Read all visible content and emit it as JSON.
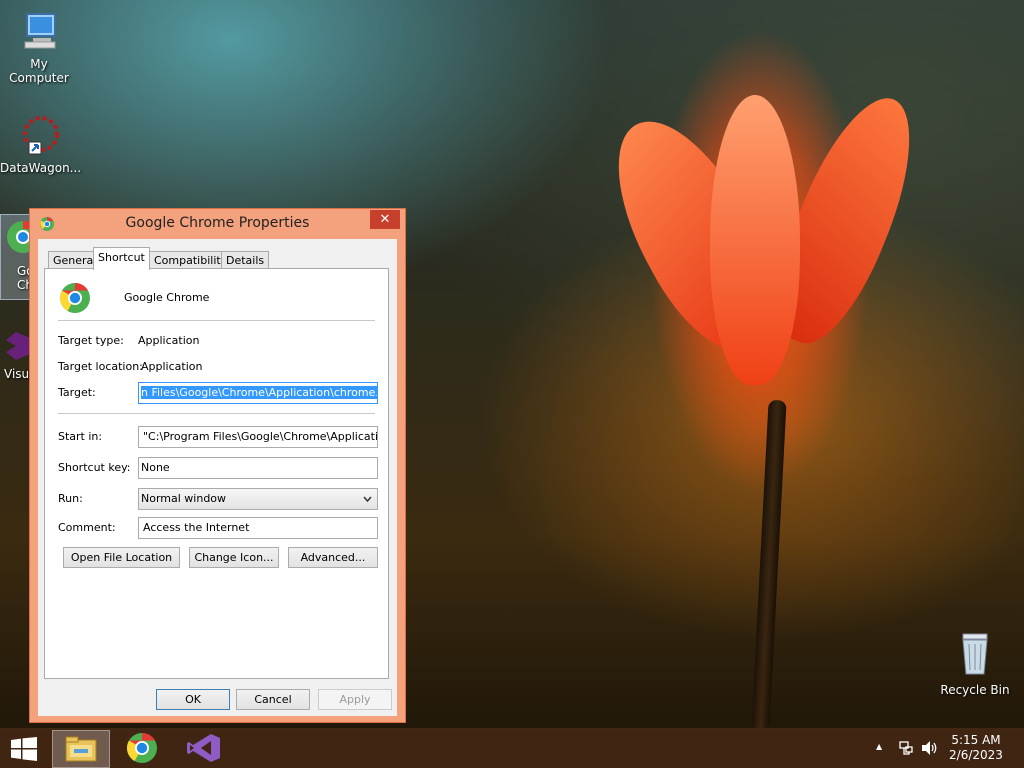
{
  "desktop": {
    "icons": [
      {
        "label": "My Computer"
      },
      {
        "label": "DataWagon..."
      },
      {
        "label": "Go Chr"
      },
      {
        "label": "Visua"
      },
      {
        "label": "Recycle Bin"
      }
    ]
  },
  "dialog": {
    "title": "Google Chrome Properties",
    "close_glyph": "✕",
    "tabs": [
      {
        "label": "General"
      },
      {
        "label": "Shortcut"
      },
      {
        "label": "Compatibility"
      },
      {
        "label": "Details"
      }
    ],
    "active_tab": "Shortcut",
    "app_name": "Google Chrome",
    "target_type_label": "Target type:",
    "target_type_value": "Application",
    "target_location_label": "Target location:",
    "target_location_value": "Application",
    "target_label": "Target:",
    "target_value": "n Files\\Google\\Chrome\\Application\\chrome.exe\"",
    "start_in_label": "Start in:",
    "start_in_value": "\"C:\\Program Files\\Google\\Chrome\\Application\"",
    "shortcut_key_label": "Shortcut key:",
    "shortcut_key_value": "None",
    "run_label": "Run:",
    "run_value": "Normal window",
    "comment_label": "Comment:",
    "comment_value": "Access the Internet",
    "buttons": {
      "open_file_location": "Open File Location",
      "change_icon": "Change Icon...",
      "advanced": "Advanced...",
      "ok": "OK",
      "cancel": "Cancel",
      "apply": "Apply"
    }
  },
  "taskbar": {
    "time": "5:15 AM",
    "date": "2/6/2023",
    "tray_up_glyph": "▲"
  },
  "colors": {
    "dialog_frame": "#f4a27e",
    "selection": "#3399ff",
    "close": "#c7402c"
  }
}
